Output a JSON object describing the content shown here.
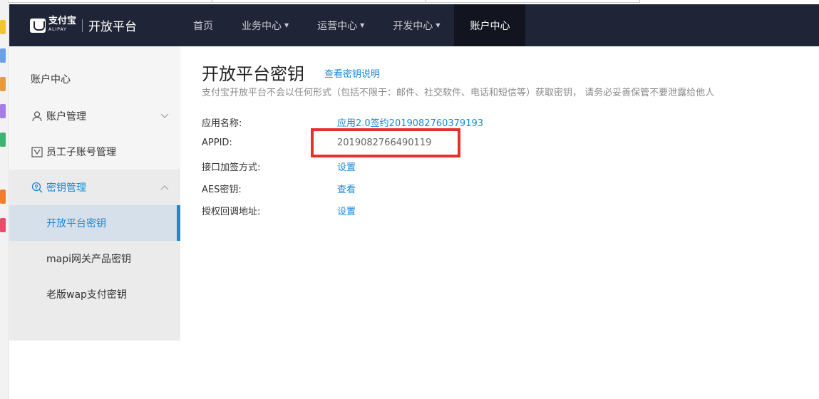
{
  "brand": {
    "logo_text": "支付宝",
    "logo_sub": "ALIPAY",
    "title": "开放平台"
  },
  "nav": {
    "items": [
      {
        "label": "首页",
        "dropdown": false,
        "active": false
      },
      {
        "label": "业务中心",
        "dropdown": true,
        "active": false
      },
      {
        "label": "运营中心",
        "dropdown": true,
        "active": false
      },
      {
        "label": "开发中心",
        "dropdown": true,
        "active": false
      },
      {
        "label": "账户中心",
        "dropdown": false,
        "active": true
      }
    ]
  },
  "sidebar": {
    "title": "账户中心",
    "menus": [
      {
        "label": "账户管理",
        "icon": "user-icon",
        "expanded": false
      },
      {
        "label": "员工子账号管理",
        "icon": "staff-icon",
        "expanded": false
      },
      {
        "label": "密钥管理",
        "icon": "key-search-icon",
        "expanded": true
      }
    ],
    "submenu": [
      {
        "label": "开放平台密钥",
        "active": true
      },
      {
        "label": "mapi网关产品密钥",
        "active": false
      },
      {
        "label": "老版wap支付密钥",
        "active": false
      }
    ]
  },
  "main": {
    "title": "开放平台密钥",
    "help_link": "查看密钥说明",
    "subtitle": "支付宝开放平台不会以任何形式（包括不限于：邮件、社交软件、电话和短信等）获取密钥， 请务必妥善保管不要泄露给他人",
    "fields": [
      {
        "key": "应用名称:",
        "value": "应用2.0签约2019082760379193",
        "type": "link"
      },
      {
        "key": "APPID:",
        "value": "2019082766490119",
        "type": "plain"
      },
      {
        "key": "接口加签方式:",
        "value": "设置",
        "type": "link"
      },
      {
        "key": "AES密钥:",
        "value": "查看",
        "type": "link"
      },
      {
        "key": "授权回调地址:",
        "value": "设置",
        "type": "link"
      }
    ]
  },
  "colors": {
    "navbar": "#1f2537",
    "nav_active": "#12151f",
    "link": "#1a87d8",
    "highlight": "#e8302a"
  }
}
